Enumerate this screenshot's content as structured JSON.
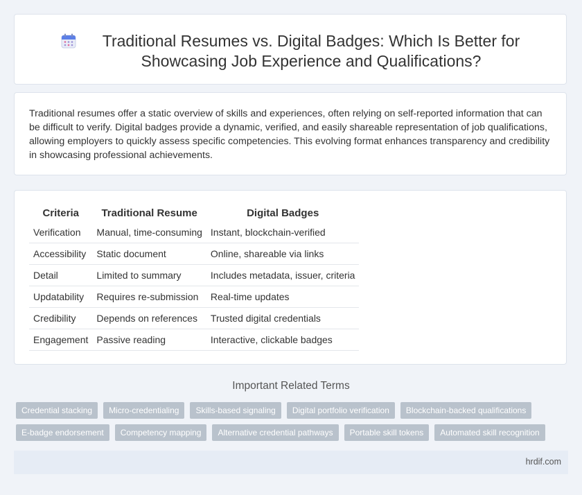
{
  "header": {
    "title": "Traditional Resumes vs. Digital Badges: Which Is Better for Showcasing Job Experience and Qualifications?",
    "icon": "calendar-icon"
  },
  "intro": "Traditional resumes offer a static overview of skills and experiences, often relying on self-reported information that can be difficult to verify. Digital badges provide a dynamic, verified, and easily shareable representation of job qualifications, allowing employers to quickly assess specific competencies. This evolving format enhances transparency and credibility in showcasing professional achievements.",
  "table": {
    "headers": [
      "Criteria",
      "Traditional Resume",
      "Digital Badges"
    ],
    "rows": [
      [
        "Verification",
        "Manual, time-consuming",
        "Instant, blockchain-verified"
      ],
      [
        "Accessibility",
        "Static document",
        "Online, shareable via links"
      ],
      [
        "Detail",
        "Limited to summary",
        "Includes metadata, issuer, criteria"
      ],
      [
        "Updatability",
        "Requires re-submission",
        "Real-time updates"
      ],
      [
        "Credibility",
        "Depends on references",
        "Trusted digital credentials"
      ],
      [
        "Engagement",
        "Passive reading",
        "Interactive, clickable badges"
      ]
    ]
  },
  "related": {
    "title": "Important Related Terms",
    "tags_row1": [
      "Credential stacking",
      "Micro-credentialing",
      "Skills-based signaling",
      "Digital portfolio verification",
      "Blockchain-backed qualifications"
    ],
    "tags_row2": [
      "E-badge endorsement",
      "Competency mapping",
      "Alternative credential pathways",
      "Portable skill tokens",
      "Automated skill recognition"
    ]
  },
  "footer": {
    "site": "hrdif.com"
  }
}
